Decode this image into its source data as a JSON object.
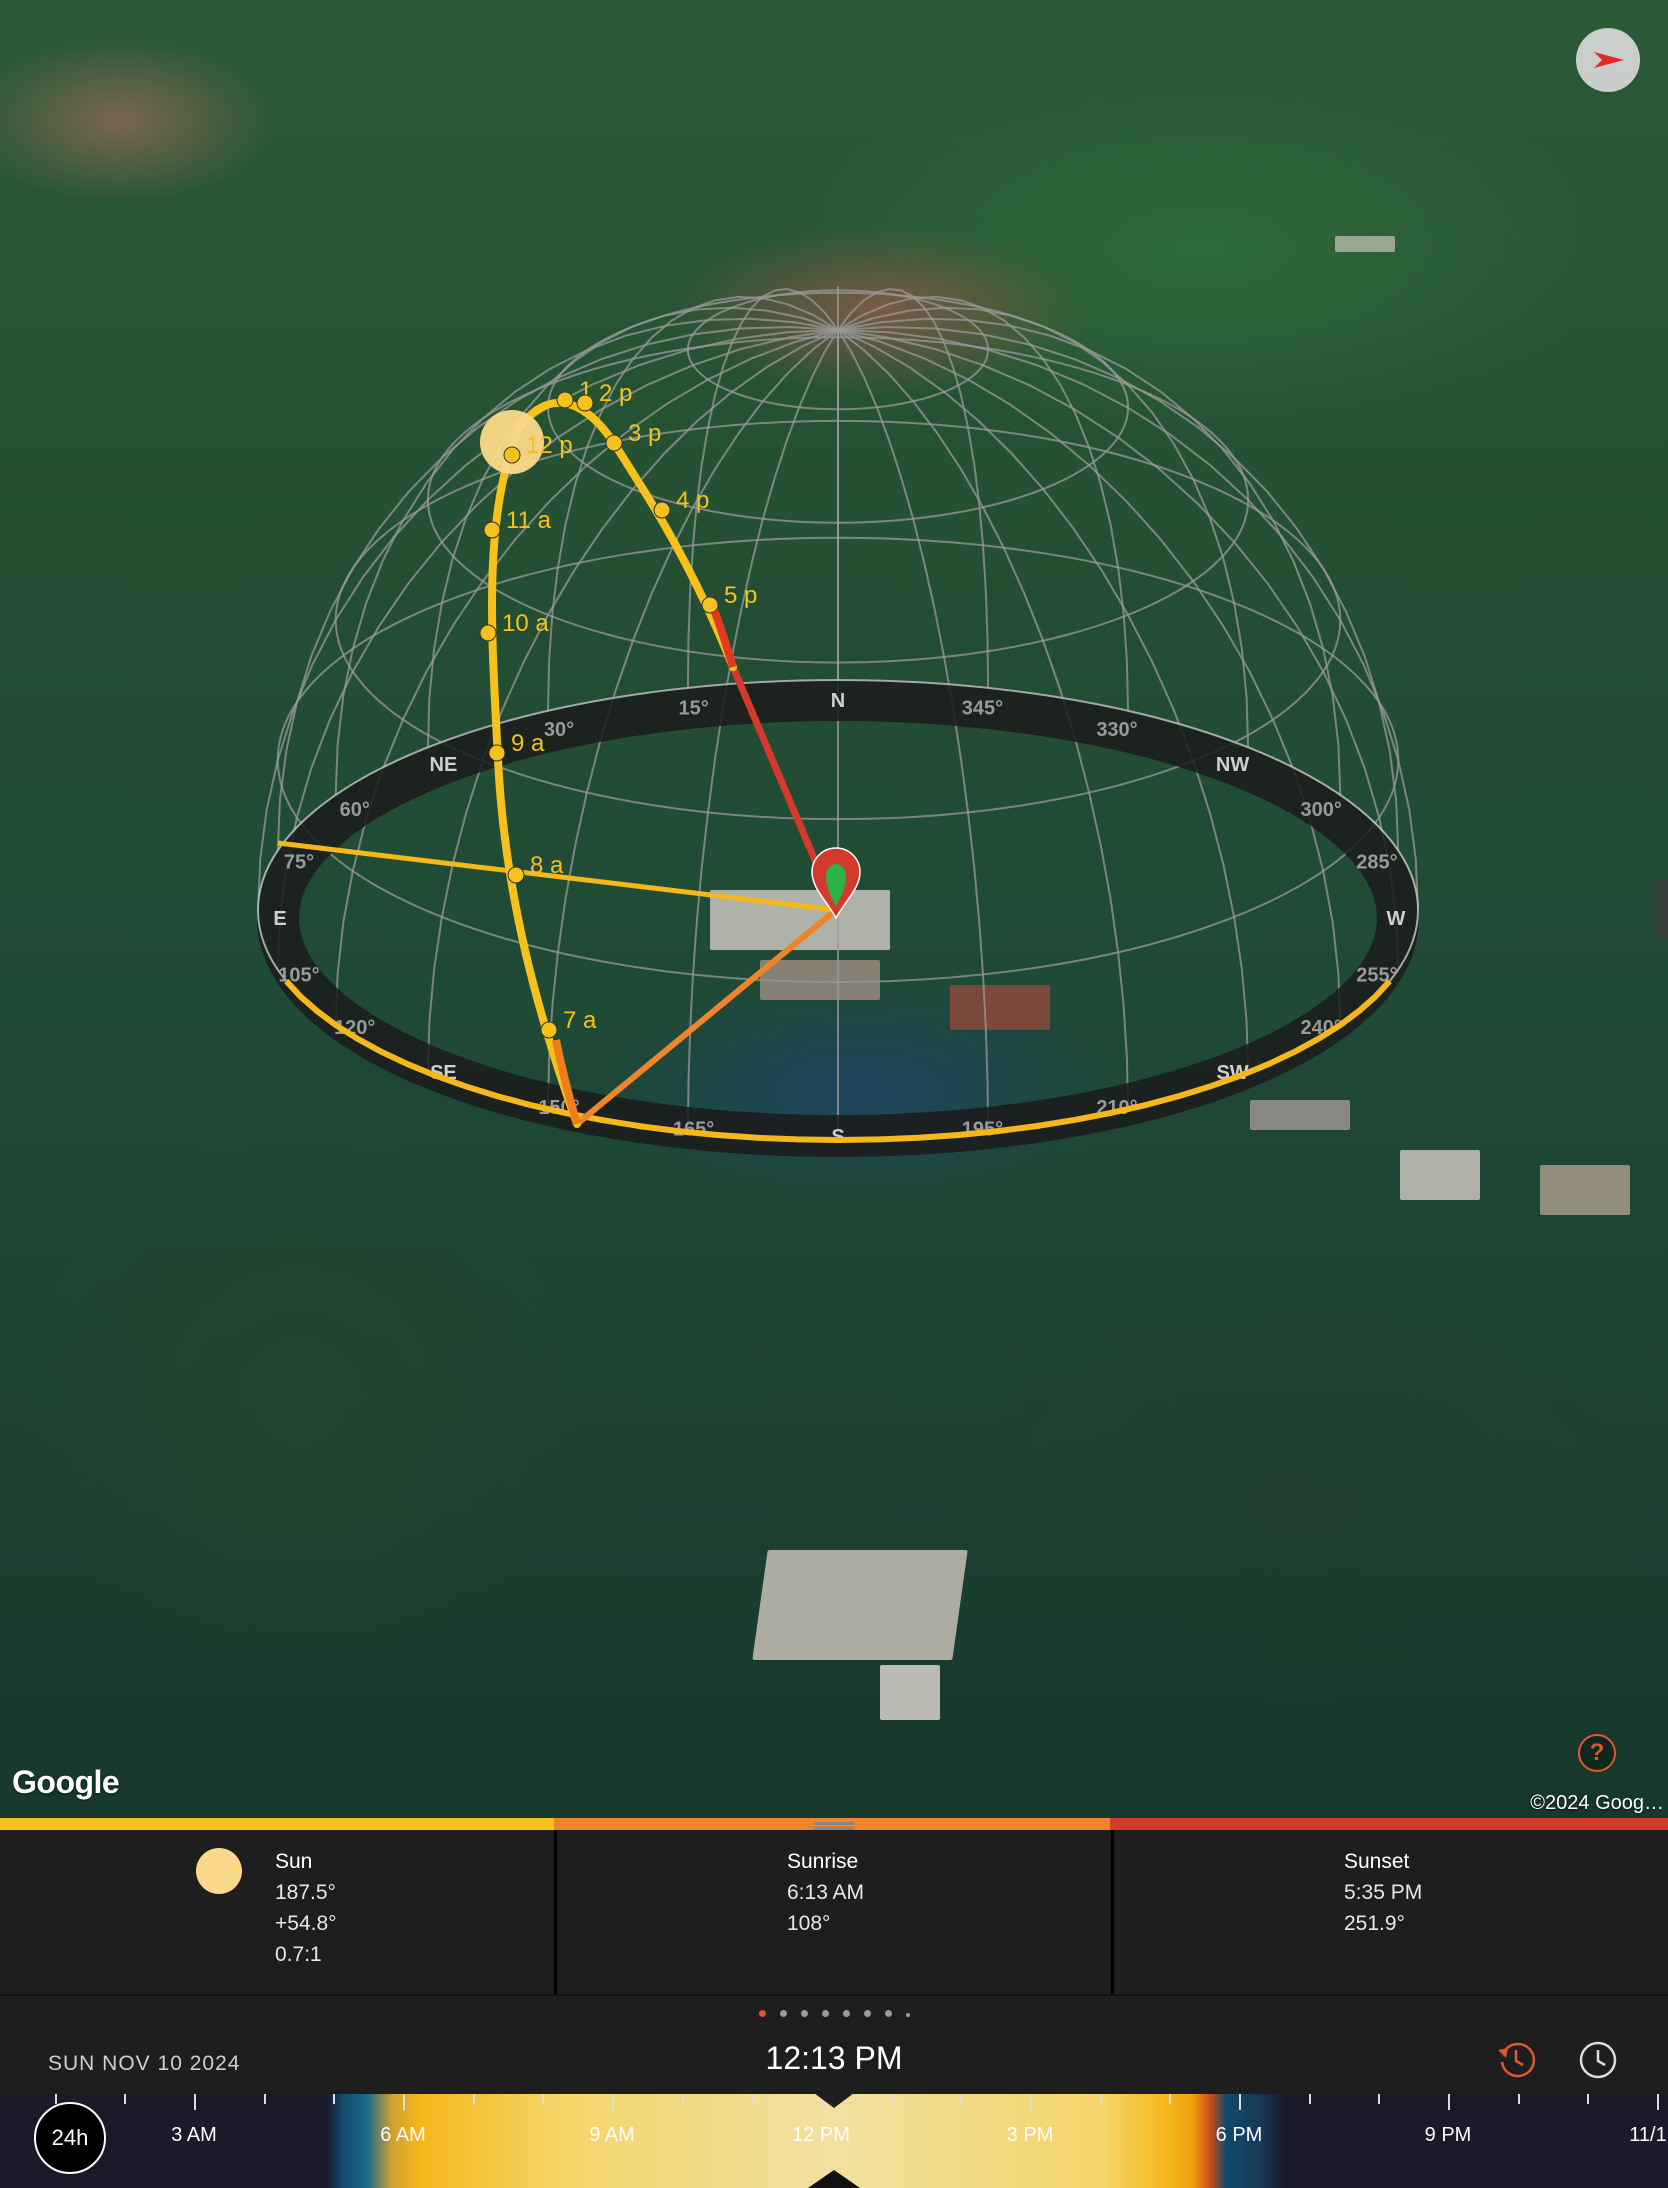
{
  "map": {
    "attribution_logo": "Google",
    "copyright": "©2024 Goog…",
    "help_label": "?",
    "compass_icon": "red-arrow-icon",
    "hour_labels": [
      "1",
      "2 p",
      "12 p",
      "3 p",
      "4 p",
      "5 p",
      "11 a",
      "10 a",
      "9 a",
      "8 a",
      "7 a"
    ],
    "ring_labels": [
      "240°",
      "255°",
      "W",
      "285°",
      "300°",
      "NW",
      "330°",
      "345°",
      "N",
      "15°",
      "30°",
      "NE",
      "60°",
      "75°",
      "E",
      "105°",
      "120°",
      "SE",
      "150°",
      "165°",
      "S",
      "195°",
      "210°",
      "SW"
    ]
  },
  "panel": {
    "colors": {
      "sun": "#f5c11c",
      "sunrise": "#f0842a",
      "sunset": "#d43a2c"
    },
    "sun": {
      "title": "Sun",
      "azimuth": "187.5°",
      "elevation": "+54.8°",
      "ratio": "0.7:1"
    },
    "sunrise": {
      "title": "Sunrise",
      "time": "6:13 AM",
      "azimuth": "108°"
    },
    "sunset": {
      "title": "Sunset",
      "time": "5:35 PM",
      "azimuth": "251.9°"
    }
  },
  "footer": {
    "date": "SUN NOV 10 2024",
    "time": "12:13 PM",
    "page_count": 8,
    "active_page": 0,
    "reset_icon": "history-icon",
    "clock_icon": "clock-icon"
  },
  "timeline": {
    "mode_button": "24h",
    "labels": [
      "3 AM",
      "6 AM",
      "9 AM",
      "12 PM",
      "3 PM",
      "6 PM",
      "9 PM",
      "11/1"
    ]
  }
}
